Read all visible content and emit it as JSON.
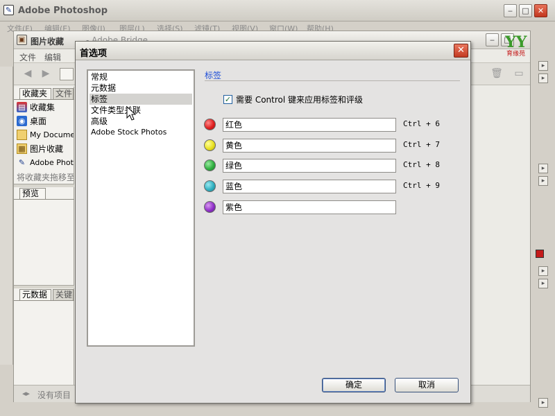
{
  "photoshop": {
    "title": "Adobe Photoshop",
    "menu": [
      "文件(F)",
      "编辑(E)",
      "图像(I)",
      "图层(L)",
      "选择(S)",
      "滤镜(T)",
      "视图(V)",
      "窗口(W)",
      "帮助(H)"
    ]
  },
  "bridge": {
    "title": "图片收藏",
    "title_suffix": "- Adobe Bridge",
    "menu": [
      "文件",
      "编辑"
    ],
    "left_tabs": [
      "收藏夹",
      "文件"
    ],
    "favorites": [
      {
        "label": "收藏集",
        "icon": "collections-icon"
      },
      {
        "label": "桌面",
        "icon": "desktop-icon"
      },
      {
        "label": "My Documents",
        "icon": "folder-icon"
      },
      {
        "label": "图片收藏",
        "icon": "pictures-folder-icon"
      },
      {
        "label": "Adobe Photoshop",
        "icon": "photoshop-icon"
      }
    ],
    "drag_hint": "将收藏夹拖移至",
    "preview_tab": "预览",
    "meta_tabs": [
      "元数据",
      "关键字"
    ],
    "status": "没有项目"
  },
  "logo": {
    "mark": "YY",
    "text": "育缘苑"
  },
  "dialog": {
    "title": "首选项",
    "close_glyph": "✕",
    "categories": [
      "常规",
      "元数据",
      "标签",
      "文件类型关联",
      "高级",
      "Adobe Stock Photos"
    ],
    "selected_category": "标签",
    "section_title": "标签",
    "require_control": {
      "checked": true,
      "label": "需要 Control 键来应用标签和评级"
    },
    "labels": [
      {
        "color": "#e02020",
        "name": "红色",
        "shortcut": "Ctrl + 6"
      },
      {
        "color": "#e8e020",
        "name": "黄色",
        "shortcut": "Ctrl + 7"
      },
      {
        "color": "#30b040",
        "name": "绿色",
        "shortcut": "Ctrl + 8"
      },
      {
        "color": "#30b0c0",
        "name": "蓝色",
        "shortcut": "Ctrl + 9"
      },
      {
        "color": "#9030c8",
        "name": "紫色",
        "shortcut": ""
      }
    ],
    "ok_label": "确定",
    "cancel_label": "取消"
  },
  "colors": {
    "section_title": "#1f4fd8",
    "selection": "#d4d3d0"
  }
}
